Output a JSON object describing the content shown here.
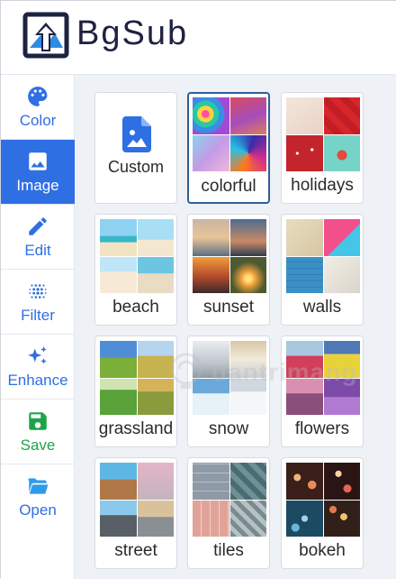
{
  "app": {
    "brand": "BgSub"
  },
  "colors": {
    "accent": "#2f6fe4",
    "brand_dark": "#1d2340",
    "green": "#1fa34a",
    "blue": "#2f6fe4"
  },
  "sidebar": {
    "items": [
      {
        "label": "Color",
        "icon": "palette-icon"
      },
      {
        "label": "Image",
        "icon": "image-icon",
        "active": true
      },
      {
        "label": "Edit",
        "icon": "pencil-icon"
      },
      {
        "label": "Filter",
        "icon": "dots-grid-icon"
      },
      {
        "label": "Enhance",
        "icon": "sparkles-icon"
      },
      {
        "label": "Save",
        "icon": "floppy-disk-icon"
      },
      {
        "label": "Open",
        "icon": "folder-open-icon"
      }
    ]
  },
  "gallery": {
    "custom_label": "Custom",
    "categories": [
      {
        "label": "colorful",
        "selected": true
      },
      {
        "label": "holidays"
      },
      {
        "label": "beach"
      },
      {
        "label": "sunset"
      },
      {
        "label": "walls"
      },
      {
        "label": "grassland"
      },
      {
        "label": "snow"
      },
      {
        "label": "flowers"
      },
      {
        "label": "street"
      },
      {
        "label": "tiles"
      },
      {
        "label": "bokeh"
      }
    ]
  },
  "watermark": {
    "text": "uantrimang"
  }
}
